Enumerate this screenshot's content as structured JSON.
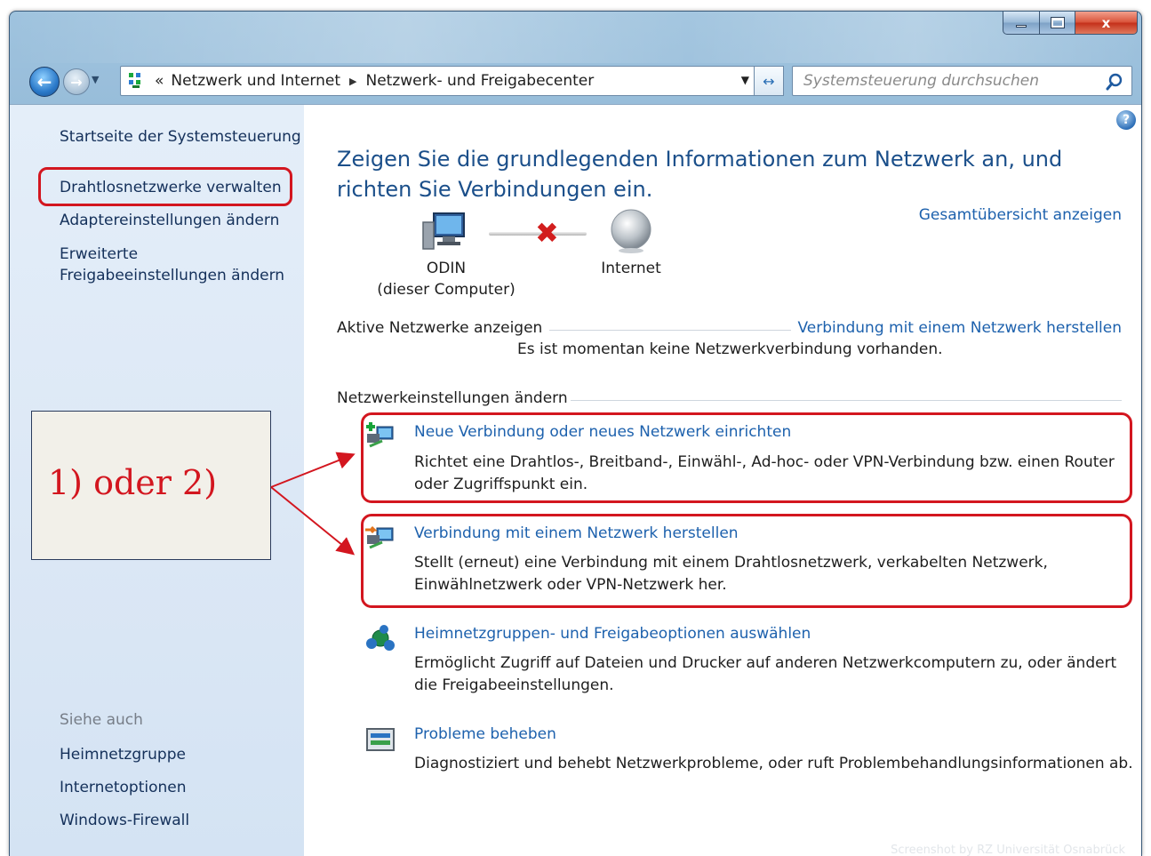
{
  "window": {
    "caption_min_icon": "minimize-icon",
    "caption_max_icon": "maximize-icon",
    "caption_close_label": "x"
  },
  "navbar": {
    "back_icon": "back-arrow-icon",
    "forward_icon": "forward-arrow-icon",
    "breadcrumb_prefix": "«",
    "breadcrumb": [
      "Netzwerk und Internet",
      "Netzwerk- und Freigabecenter"
    ],
    "search_placeholder": "Systemsteuerung durchsuchen"
  },
  "sidebar": {
    "home": "Startseite der Systemsteuerung",
    "items": [
      "Drahtlosnetzwerke verwalten",
      "Adaptereinstellungen ändern",
      "Erweiterte Freigabeeinstellungen ändern"
    ],
    "see_also_title": "Siehe auch",
    "see_also": [
      "Heimnetzgruppe",
      "Internetoptionen",
      "Windows-Firewall"
    ]
  },
  "main": {
    "title": "Zeigen Sie die grundlegenden Informationen zum Netzwerk an, und richten Sie Verbindungen ein.",
    "overview_link": "Gesamtübersicht anzeigen",
    "computer_name": "ODIN",
    "computer_sub": "(dieser Computer)",
    "internet_label": "Internet",
    "active_networks_label": "Aktive Netzwerke anzeigen",
    "connect_link": "Verbindung mit einem Netzwerk herstellen",
    "no_connection_text": "Es ist momentan keine Netzwerkverbindung vorhanden.",
    "settings_label": "Netzwerkeinstellungen ändern",
    "tasks": [
      {
        "title": "Neue Verbindung oder neues Netzwerk einrichten",
        "desc": "Richtet eine Drahtlos-, Breitband-, Einwähl-, Ad-hoc- oder VPN-Verbindung bzw. einen Router oder Zugriffspunkt ein.",
        "icon": "new-connection-icon"
      },
      {
        "title": "Verbindung mit einem Netzwerk herstellen",
        "desc": "Stellt (erneut) eine Verbindung mit einem Drahtlosnetzwerk, verkabelten Netzwerk, Einwählnetzwerk oder VPN-Netzwerk her.",
        "icon": "connect-network-icon"
      },
      {
        "title": "Heimnetzgruppen- und Freigabeoptionen auswählen",
        "desc": "Ermöglicht Zugriff auf Dateien und Drucker auf anderen Netzwerkcomputern zu, oder ändert die Freigabeeinstellungen.",
        "icon": "homegroup-icon"
      },
      {
        "title": "Probleme beheben",
        "desc": "Diagnostiziert und behebt Netzwerkprobleme, oder ruft Problembehandlungsinformationen ab.",
        "icon": "troubleshoot-icon"
      }
    ]
  },
  "annotation": {
    "label": "1) oder 2)",
    "color": "#d3161f"
  },
  "watermark": "Screenshot by RZ Universität Osnabrück",
  "colors": {
    "link": "#1d61ad",
    "title": "#1b4f8a",
    "highlight": "#d3161f",
    "sidebar_bg": "#dbe7f5"
  }
}
